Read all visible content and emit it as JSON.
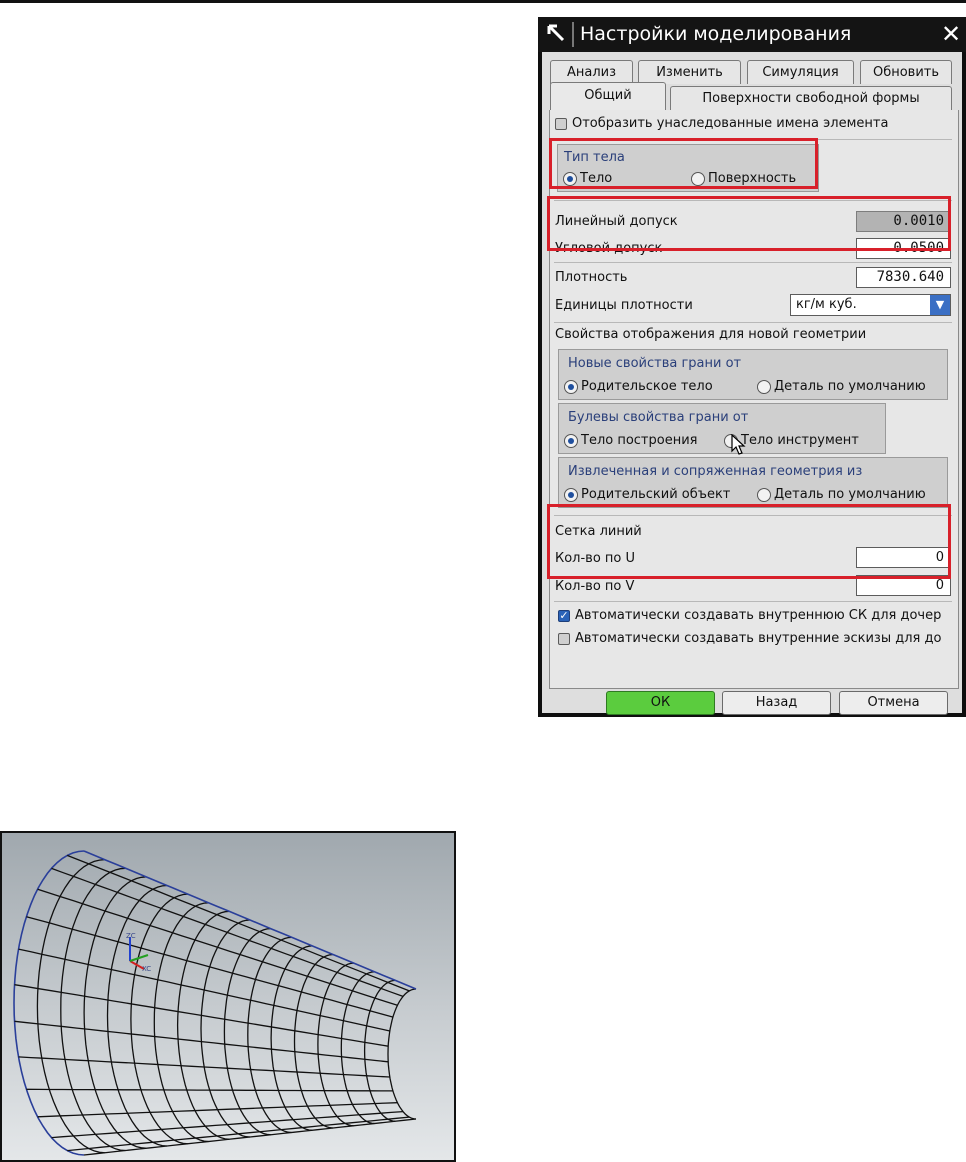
{
  "dialog": {
    "title": "Настройки моделирования",
    "close_glyph": "✕",
    "tabs_top": [
      "Анализ",
      "Изменить",
      "Симуляция",
      "Обновить"
    ],
    "tabs_bottom": [
      "Общий",
      "Поверхности свободной формы"
    ],
    "active_tab": "Общий",
    "show_inherited_names": {
      "label": "Отобразить унаследованные имена элемента",
      "checked": false
    },
    "body_type": {
      "title": "Тип тела",
      "options": [
        {
          "label": "Тело",
          "selected": true
        },
        {
          "label": "Поверхность",
          "selected": false
        }
      ]
    },
    "tolerances": {
      "linear_label": "Линейный допуск",
      "linear_value": "0.0010",
      "angular_label": "Угловой допуск",
      "angular_value": "0.0500"
    },
    "density": {
      "label": "Плотность",
      "value": "7830.640"
    },
    "density_units": {
      "label": "Единицы плотности",
      "value": "кг/м куб."
    },
    "display_props": {
      "title": "Свойства отображения для новой геометрии",
      "new_face": {
        "title": "Новые свойства грани от",
        "options": [
          {
            "label": "Родительское тело",
            "selected": true
          },
          {
            "label": "Деталь по умолчанию",
            "selected": false
          }
        ]
      },
      "boolean_face": {
        "title": "Булевы свойства грани от",
        "options": [
          {
            "label": "Тело построения",
            "selected": true
          },
          {
            "label": "Тело инструмент",
            "selected": false
          }
        ]
      },
      "extracted": {
        "title": "Извлеченная и сопряженная геометрия из",
        "options": [
          {
            "label": "Родительский объект",
            "selected": true
          },
          {
            "label": "Деталь по умолчанию",
            "selected": false
          }
        ]
      }
    },
    "grid_lines": {
      "title": "Сетка линий",
      "u_label": "Кол-во по U",
      "u_value": "0",
      "v_label": "Кол-во по V",
      "v_value": "0"
    },
    "auto_csys": {
      "label": "Автоматически создавать внутреннюю СК для дочер",
      "checked": true
    },
    "auto_sketch": {
      "label": "Автоматически создавать внутренние эскизы для до",
      "checked": false
    },
    "buttons": {
      "ok": "ОК",
      "back": "Назад",
      "cancel": "Отмена"
    }
  },
  "viewport": {
    "axes": {
      "z": "ZC",
      "x": "XC"
    },
    "colors": {
      "mesh": "#111111",
      "outline": "#2a3f9a",
      "x_axis": "#d02020",
      "y_axis": "#22a020",
      "z_axis": "#2040d0"
    }
  }
}
